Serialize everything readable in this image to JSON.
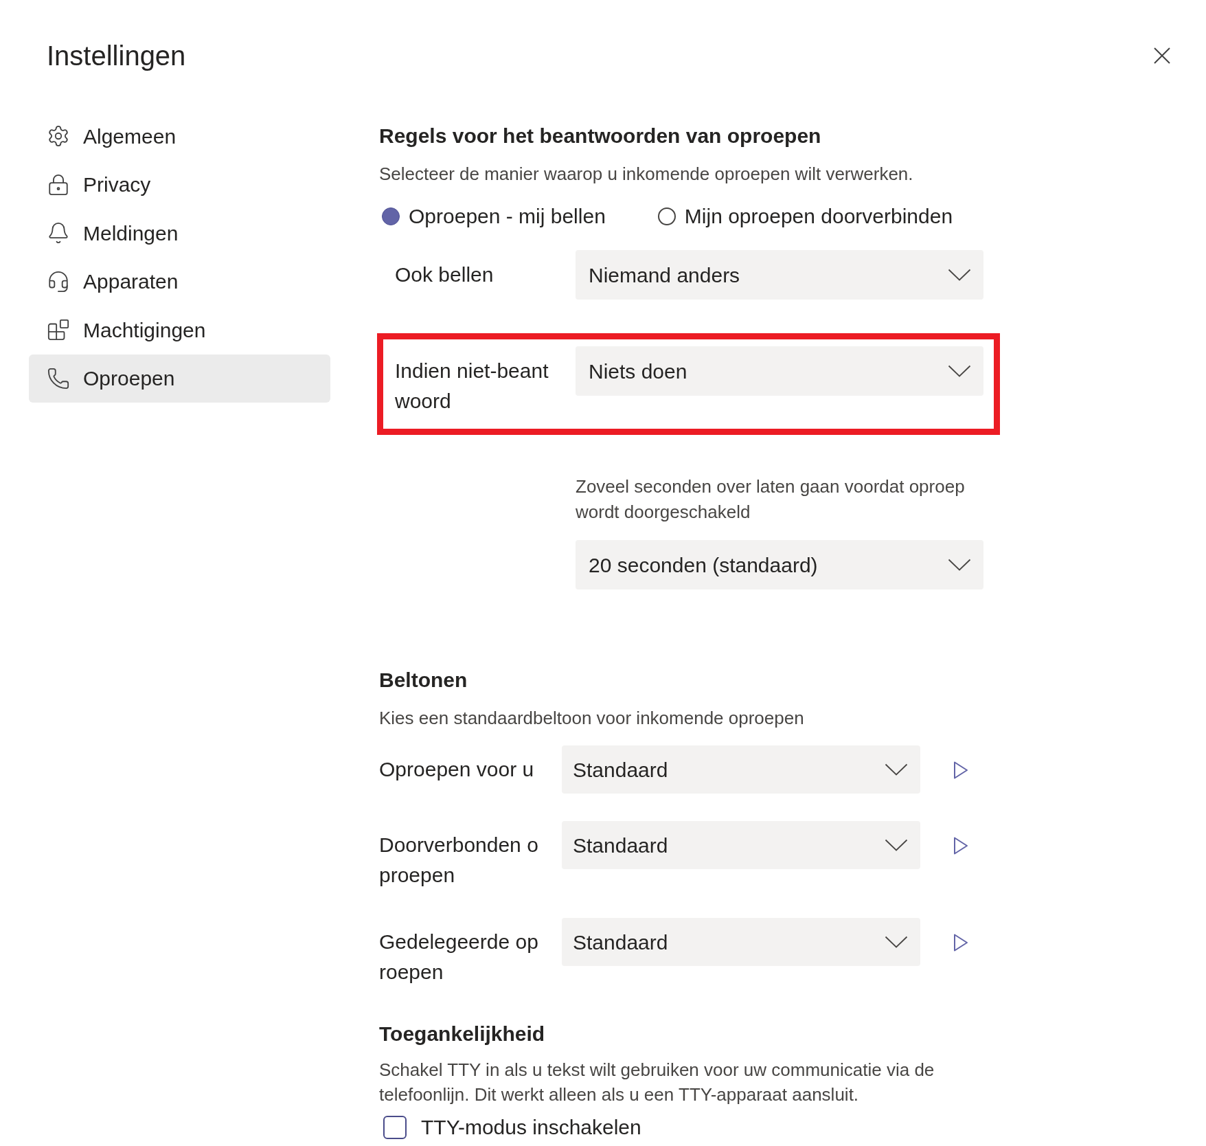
{
  "window": {
    "title": "Instellingen"
  },
  "sidebar": {
    "items": [
      {
        "label": "Algemeen",
        "selected": false
      },
      {
        "label": "Privacy",
        "selected": false
      },
      {
        "label": "Meldingen",
        "selected": false
      },
      {
        "label": "Apparaten",
        "selected": false
      },
      {
        "label": "Machtigingen",
        "selected": false
      },
      {
        "label": "Oproepen",
        "selected": true
      }
    ]
  },
  "call_answering": {
    "heading": "Regels voor het beantwoorden van oproepen",
    "description": "Selecteer de manier waarop u inkomende oproepen wilt verwerken.",
    "options": [
      {
        "label": "Oproepen - mij bellen",
        "selected": true
      },
      {
        "label": "Mijn oproepen doorverbinden",
        "selected": false
      }
    ],
    "also_ring": {
      "label": "Ook bellen",
      "value": "Niemand anders"
    },
    "if_unanswered": {
      "label": "Indien niet-beantwoord",
      "value": "Niets doen",
      "highlighted": true
    },
    "ring_time": {
      "description": "Zoveel seconden over laten gaan voordat oproep wordt doorgeschakeld",
      "value": "20 seconden (standaard)"
    }
  },
  "ringtones": {
    "heading": "Beltonen",
    "description": "Kies een standaardbeltoon voor inkomende oproepen",
    "rows": [
      {
        "label": "Oproepen voor u",
        "value": "Standaard"
      },
      {
        "label": "Doorverbonden oproepen",
        "value": "Standaard"
      },
      {
        "label": "Gedelegeerde oproepen",
        "value": "Standaard"
      }
    ]
  },
  "accessibility": {
    "heading": "Toegankelijkheid",
    "description": "Schakel TTY in als u tekst wilt gebruiken voor uw communicatie via de telefoonlijn. Dit werkt alleen als u een TTY-apparaat aansluit.",
    "checkbox": {
      "label": "TTY-modus inschakelen",
      "checked": false
    }
  }
}
